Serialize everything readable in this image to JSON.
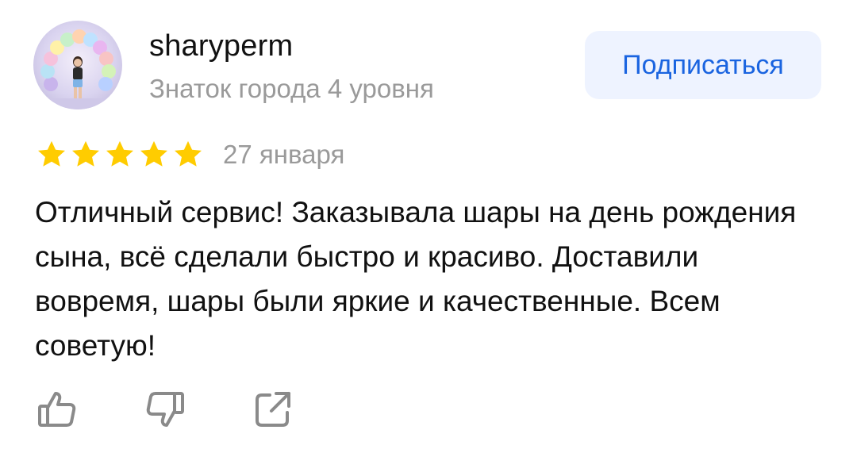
{
  "author": {
    "name": "sharyperm",
    "level": "Знаток города 4 уровня"
  },
  "subscribe_label": "Подписаться",
  "rating": {
    "stars": 5,
    "max": 5,
    "star_color": "#FFCC00"
  },
  "review": {
    "date": "27 января",
    "text": "Отличный сервис! Заказывала шары на день рождения сына, всё сделали быстро и красиво. Доставили вовремя, шары были яркие и качественные. Всем советую!"
  },
  "actions": [
    {
      "icon": "thumbs-up-icon"
    },
    {
      "icon": "thumbs-down-icon"
    },
    {
      "icon": "share-icon"
    }
  ],
  "colors": {
    "accent": "#1A64E0",
    "button_bg": "#EEF3FF",
    "muted_text": "#9A9A9A"
  }
}
